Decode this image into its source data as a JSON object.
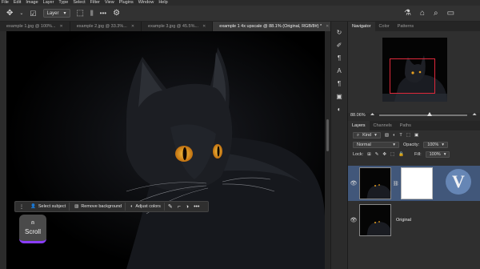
{
  "menu": [
    "File",
    "Edit",
    "Image",
    "Layer",
    "Type",
    "Select",
    "Filter",
    "View",
    "Plugins",
    "Window",
    "Help"
  ],
  "options": {
    "layer_select": "Layer"
  },
  "tabs": [
    {
      "label": "example 1.jpg @ 100%...",
      "active": false
    },
    {
      "label": "example 2.jpg @ 33.3%...",
      "active": false
    },
    {
      "label": "example 3.jpg @ 45.5%...",
      "active": false
    },
    {
      "label": "example 1 4x upscale @ 88.1% (Original, RGB/8#) *",
      "active": true
    }
  ],
  "taskbar": {
    "select_subject": "Select subject",
    "remove_background": "Remove background",
    "adjust_colors": "Adjust colors"
  },
  "scroll_badge": "Scroll",
  "navigator": {
    "tabs": [
      "Navigator",
      "Color",
      "Patterns"
    ],
    "zoom": "88.06%"
  },
  "layers_panel": {
    "tabs": [
      "Layers",
      "Channels",
      "Paths"
    ],
    "kind": "Kind",
    "blend_mode": "Normal",
    "opacity_label": "Opacity:",
    "opacity": "100%",
    "lock_label": "Lock:",
    "fill_label": "Fill:",
    "fill": "100%",
    "layers": [
      {
        "name": "",
        "selected": true,
        "has_mask": true
      },
      {
        "name": "Original",
        "selected": false,
        "has_mask": false
      }
    ]
  },
  "colors": {
    "accent_purple": "#8b3dff",
    "selection_blue": "#41577a",
    "nav_frame": "#e0283a",
    "cat_eye": "#e8a020"
  }
}
